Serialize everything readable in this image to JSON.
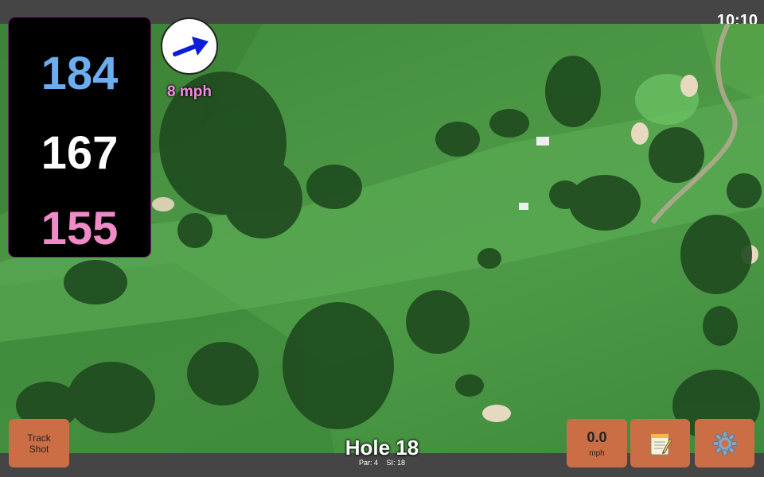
{
  "status_bar": {
    "time": "10:10"
  },
  "distances": {
    "back": "184",
    "middle": "167",
    "front": "155"
  },
  "wind": {
    "speed": "8 mph",
    "direction_icon": "arrow-northeast-icon"
  },
  "hole": {
    "title": "Hole 18",
    "par": "Par: 4",
    "stroke_index": "SI: 18"
  },
  "buttons": {
    "track_shot_line1": "Track",
    "track_shot_line2": "Shot",
    "speed_value": "0.0",
    "speed_unit": "mph",
    "notes_icon": "notepad-icon",
    "settings_icon": "gear-icon"
  },
  "colors": {
    "back_distance": "#6aaef0",
    "middle_distance": "#ffffff",
    "front_distance": "#f08ac8",
    "wind_text": "#f48ae4",
    "button_bg": "#cc6e45"
  }
}
